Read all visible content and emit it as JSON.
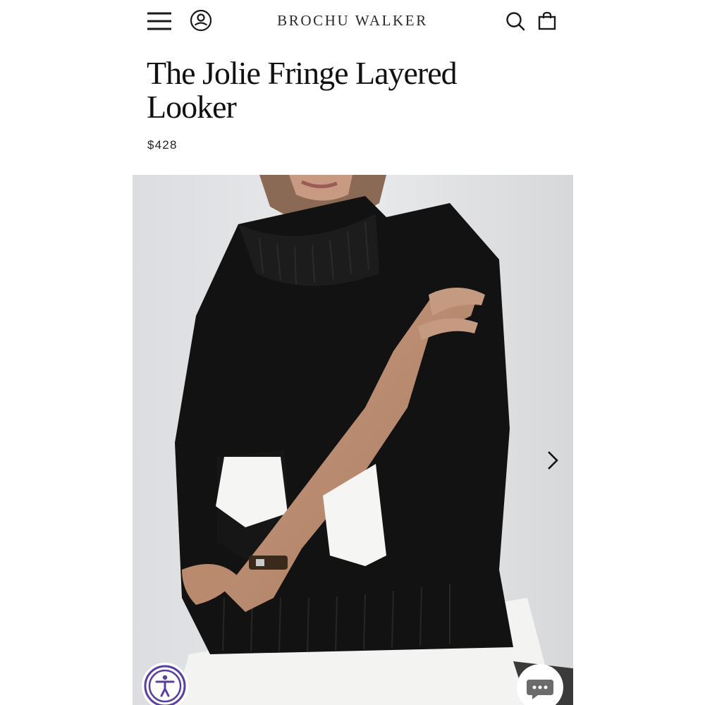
{
  "header": {
    "brand": "BROCHU WALKER",
    "icons": {
      "menu": "hamburger-menu-icon",
      "account": "account-icon",
      "search": "search-icon",
      "bag": "shopping-bag-icon"
    }
  },
  "product": {
    "title_line1": "The Jolie Fringe Layered",
    "title_line2": "Looker",
    "price": "$428"
  },
  "gallery": {
    "image_alt": "Model wearing black turtleneck sweater layered over white shirt",
    "next_icon": "chevron-right-icon"
  },
  "widgets": {
    "accessibility_icon": "accessibility-icon",
    "chat_icon": "chat-bubble-icon"
  },
  "colors": {
    "text": "#1a1a1a",
    "accessibility_accent": "#5a3fa0",
    "chat_accent": "#6b6b6b",
    "sweater": "#121212",
    "shirt": "#f3f3f1"
  }
}
